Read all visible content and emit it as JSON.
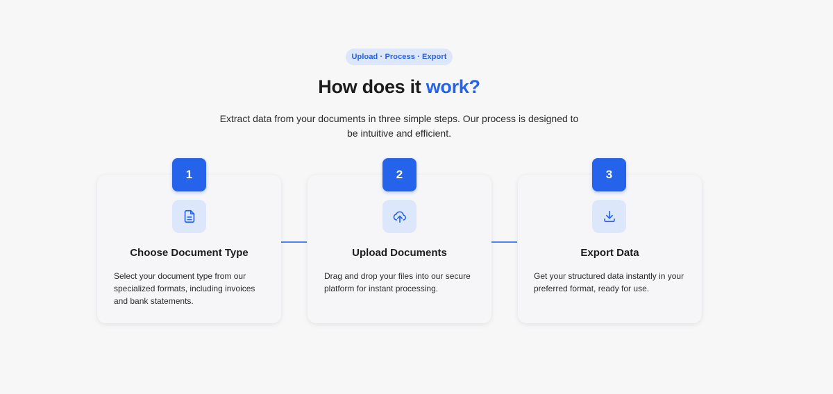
{
  "badge": "Upload · Process · Export",
  "heading": {
    "main": "How does it ",
    "accent": "work?"
  },
  "subtitle": "Extract data from your documents in three simple steps. Our process is designed to be intuitive and efficient.",
  "steps": [
    {
      "number": "1",
      "icon": "document-icon",
      "title": "Choose Document Type",
      "description": "Select your document type from our specialized formats, including invoices and bank statements."
    },
    {
      "number": "2",
      "icon": "cloud-upload-icon",
      "title": "Upload Documents",
      "description": "Drag and drop your files into our secure platform for instant processing."
    },
    {
      "number": "3",
      "icon": "download-icon",
      "title": "Export Data",
      "description": "Get your structured data instantly in your preferred format, ready for use."
    }
  ],
  "colors": {
    "accent": "#2563eb",
    "accent_light": "#dce7fb",
    "background": "#f7f7f8"
  }
}
